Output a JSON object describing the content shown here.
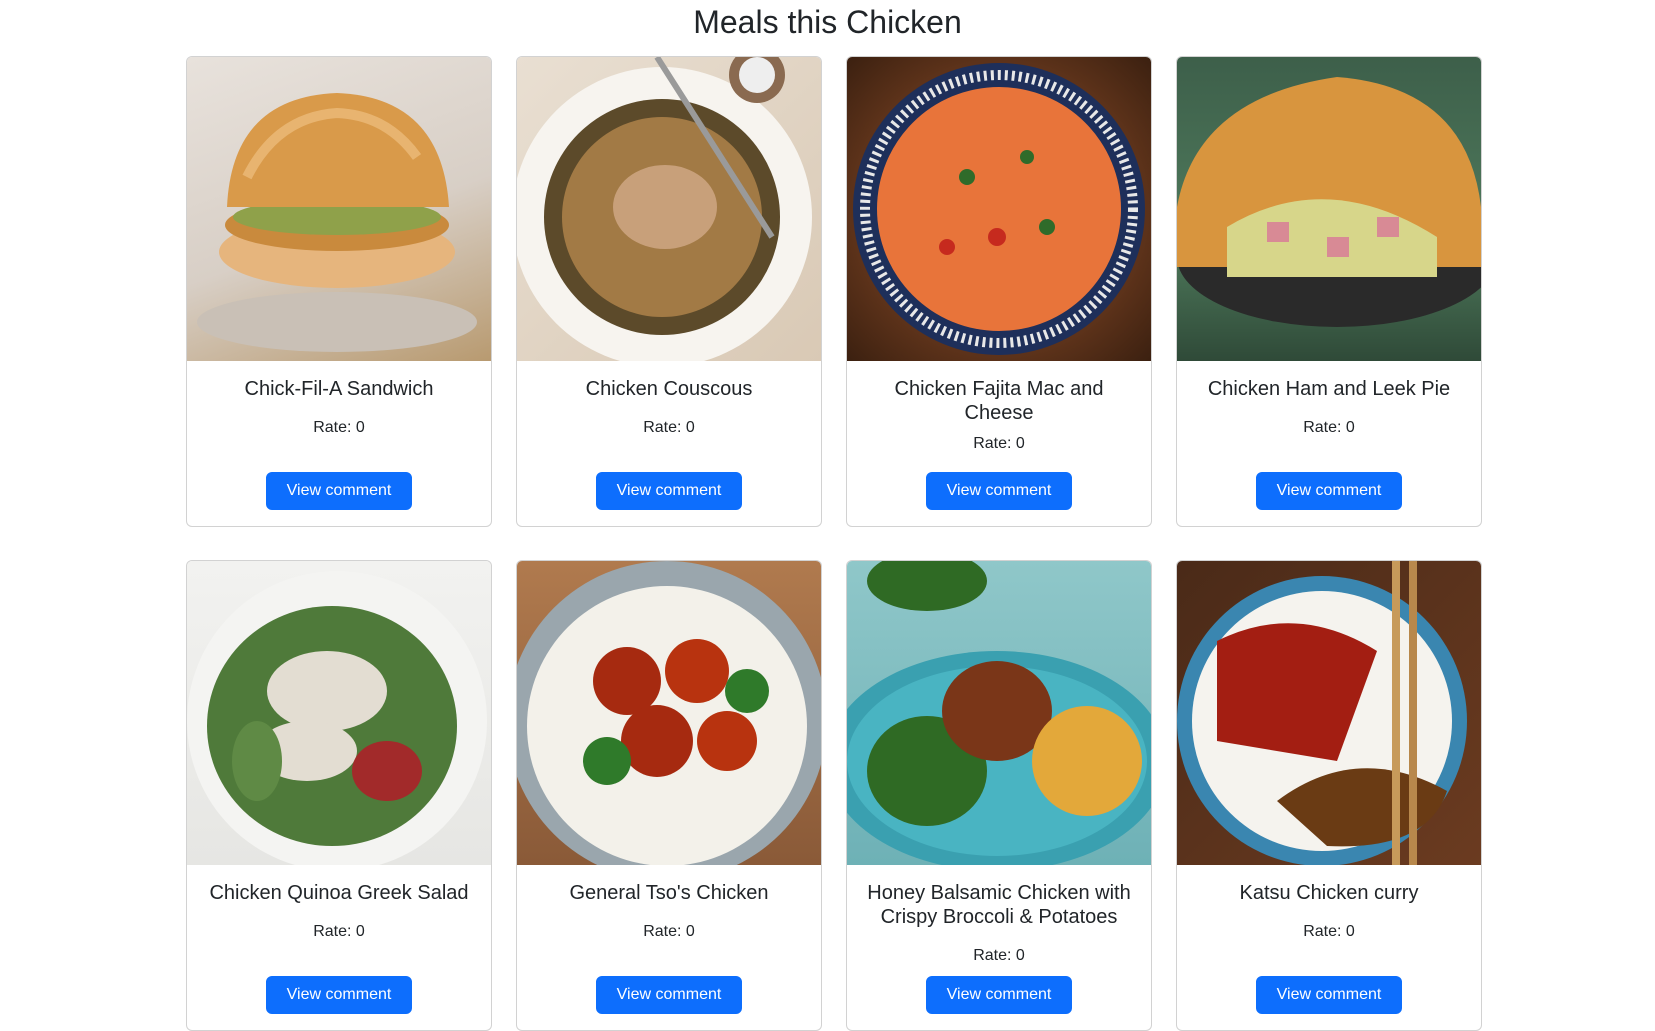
{
  "page": {
    "title": "Meals this Chicken"
  },
  "meals": [
    {
      "name": "Chick-Fil-A Sandwich",
      "rate": "Rate: 0",
      "button": "View comment"
    },
    {
      "name": "Chicken Couscous",
      "rate": "Rate: 0",
      "button": "View comment"
    },
    {
      "name": "Chicken Fajita Mac and Cheese",
      "rate": "Rate: 0",
      "button": "View comment"
    },
    {
      "name": "Chicken Ham and Leek Pie",
      "rate": "Rate: 0",
      "button": "View comment"
    },
    {
      "name": "Chicken Quinoa Greek Salad",
      "rate": "Rate: 0",
      "button": "View comment"
    },
    {
      "name": "General Tso's Chicken",
      "rate": "Rate: 0",
      "button": "View comment"
    },
    {
      "name": "Honey Balsamic Chicken with Crispy Broccoli & Potatoes",
      "rate": "Rate: 0",
      "button": "View comment"
    },
    {
      "name": "Katsu Chicken curry",
      "rate": "Rate: 0",
      "button": "View comment"
    }
  ],
  "colors": {
    "button": "#0d6efd",
    "text": "#212529",
    "border": "#dee2e6"
  }
}
